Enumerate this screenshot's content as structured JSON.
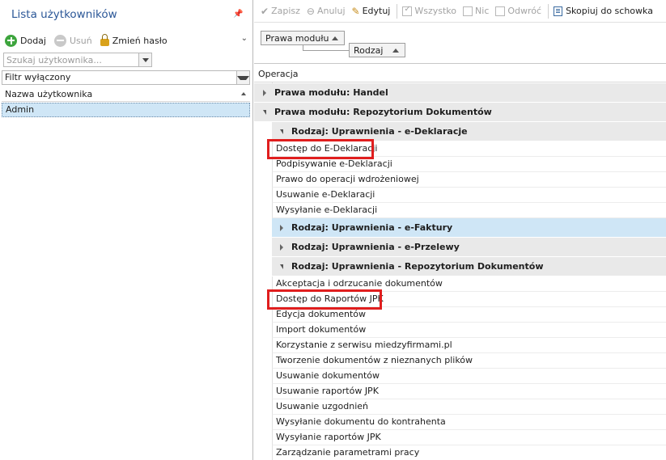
{
  "left_panel": {
    "title": "Lista użytkowników",
    "toolbar": {
      "add_label": "Dodaj",
      "delete_label": "Usuń",
      "change_password_label": "Zmień hasło"
    },
    "search": {
      "placeholder": "Szukaj użytkownika..."
    },
    "filter": {
      "value": "Filtr wyłączony"
    },
    "column_header": "Nazwa użytkownika",
    "users": [
      "Admin"
    ]
  },
  "toolbar": {
    "save_label": "Zapisz",
    "cancel_label": "Anuluj",
    "edit_label": "Edytuj",
    "all_label": "Wszystko",
    "none_label": "Nic",
    "invert_label": "Odwróć",
    "copy_label": "Skopiuj do schowka"
  },
  "group_panel": {
    "chip1": "Prawa modułu",
    "chip2": "Rodzaj"
  },
  "grid": {
    "column_header": "Operacja",
    "groups": {
      "g1": "Prawa modułu: Handel",
      "g2": "Prawa modułu: Repozytorium Dokumentów",
      "g2a": "Rodzaj: Uprawnienia - e-Deklaracje",
      "g2b": "Rodzaj: Uprawnienia - e-Faktury",
      "g2c": "Rodzaj: Uprawnienia - e-Przelewy",
      "g2d": "Rodzaj: Uprawnienia - Repozytorium Dokumentów"
    },
    "edeklaracje_items": [
      "Dostęp do E-Deklaracji",
      "Podpisywanie e-Deklaracji",
      "Prawo do operacji wdrożeniowej",
      "Usuwanie e-Deklaracji",
      "Wysyłanie e-Deklaracji"
    ],
    "repozytorium_items": [
      "Akceptacja i odrzucanie dokumentów",
      "Dostęp do Raportów JPK",
      "Edycja dokumentów",
      "Import dokumentów",
      "Korzystanie z serwisu miedzyfirmami.pl",
      "Tworzenie dokumentów z nieznanych plików",
      "Usuwanie dokumentów",
      "Usuwanie raportów JPK",
      "Usuwanie uzgodnień",
      "Wysyłanie dokumentu do kontrahenta",
      "Wysyłanie raportów JPK",
      "Zarządzanie parametrami pracy"
    ]
  },
  "colors": {
    "title_blue": "#2b5797",
    "selection": "#cfe6f6",
    "highlight_red": "#e01e1e"
  }
}
